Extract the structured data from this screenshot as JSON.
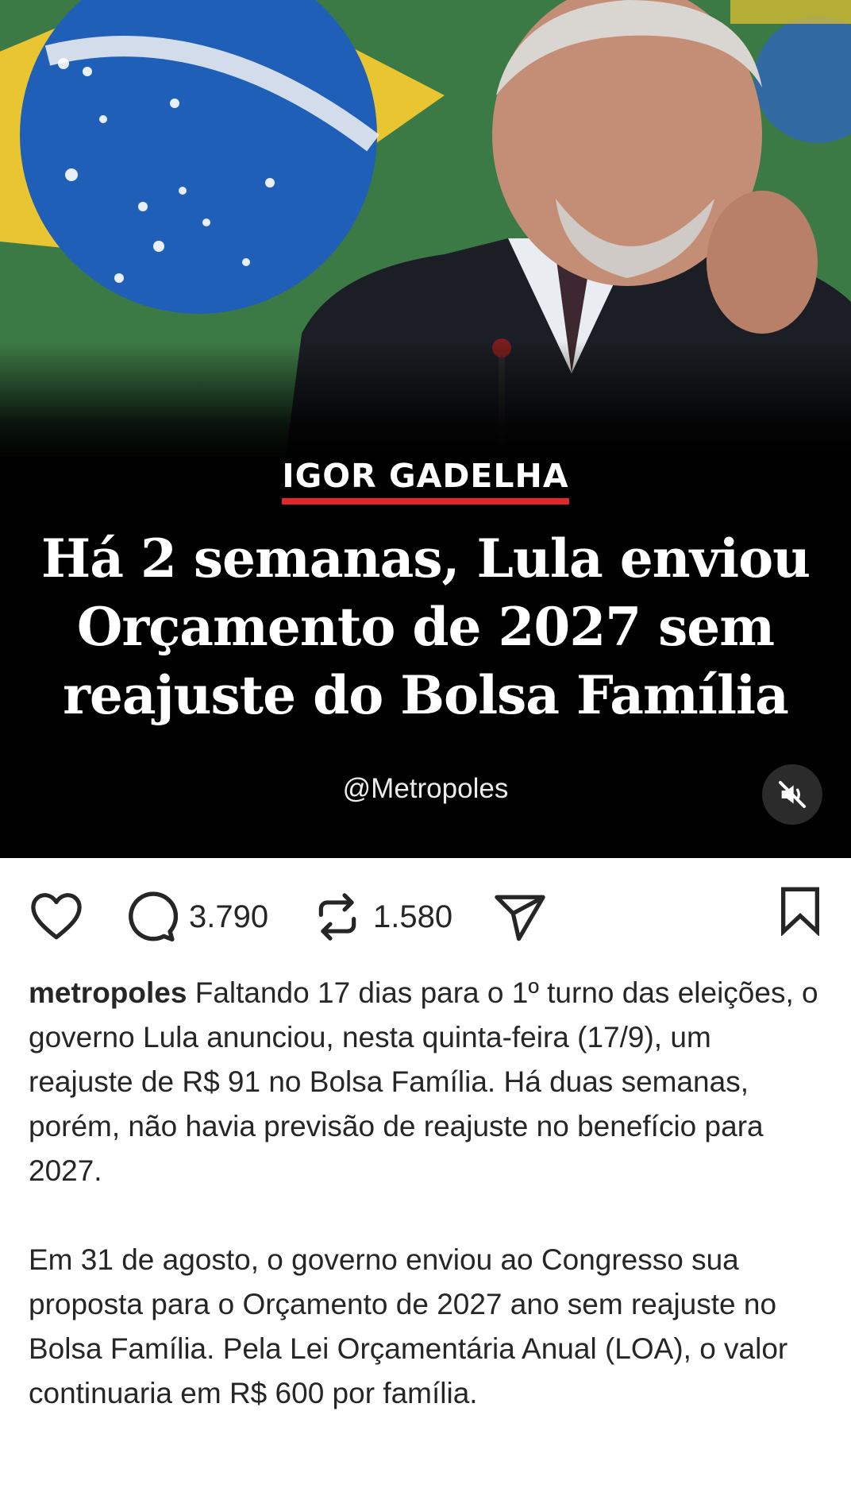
{
  "post": {
    "byline": "IGOR GADELHA",
    "headline": "Há 2 semanas, Lula enviou Orçamento de 2027 sem reajuste do Bolsa Família",
    "handle": "@Metropoles",
    "mute_icon": "speaker-muted-icon"
  },
  "actions": {
    "like_icon": "heart-icon",
    "comment_icon": "comment-icon",
    "comments_count": "3.790",
    "repost_icon": "repost-icon",
    "reposts_count": "1.580",
    "share_icon": "send-icon",
    "save_icon": "bookmark-icon"
  },
  "caption": {
    "username": "metropoles",
    "paragraph1": "Faltando 17 dias para o 1º turno das eleições, o governo Lula anunciou, nesta quinta-feira (17/9), um reajuste de R$ 91 no Bolsa Família. Há duas semanas, porém, não havia previsão de reajuste no benefício para 2027.",
    "paragraph2": "Em 31 de agosto, o governo enviou ao Congresso sua proposta para o Orçamento de 2027 ano sem reajuste no Bolsa Família. Pela Lei Orçamentária Anual (LOA), o valor continuaria em R$ 600 por família."
  },
  "colors": {
    "accent_underline": "#e3262a",
    "media_background": "#000000",
    "text": "#262626"
  }
}
